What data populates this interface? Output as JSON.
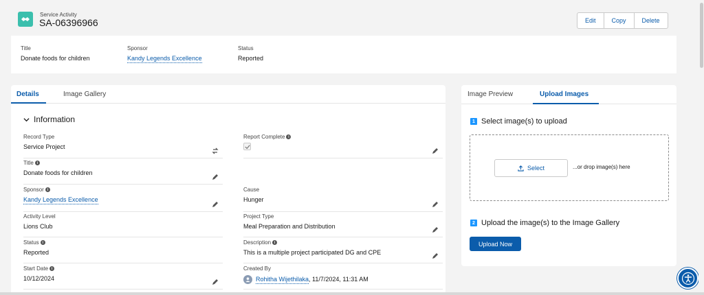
{
  "header": {
    "object_label": "Service Activity",
    "record_name": "SA-06396966",
    "icon": "handshake-icon",
    "actions": [
      "Edit",
      "Copy",
      "Delete"
    ]
  },
  "highlights": {
    "title_label": "Title",
    "title_value": "Donate foods for children",
    "sponsor_label": "Sponsor",
    "sponsor_value": "Kandy Legends Excellence",
    "status_label": "Status",
    "status_value": "Reported"
  },
  "details": {
    "tabs": [
      "Details",
      "Image Gallery"
    ],
    "section": "Information",
    "fields": {
      "record_type": {
        "label": "Record Type",
        "value": "Service Project"
      },
      "report_complete": {
        "label": "Report Complete"
      },
      "title": {
        "label": "Title",
        "value": "Donate foods for children"
      },
      "sponsor": {
        "label": "Sponsor",
        "value": "Kandy Legends Excellence"
      },
      "cause": {
        "label": "Cause",
        "value": "Hunger"
      },
      "activity_level": {
        "label": "Activity Level",
        "value": "Lions Club"
      },
      "project_type": {
        "label": "Project Type",
        "value": "Meal Preparation and Distribution"
      },
      "status": {
        "label": "Status",
        "value": "Reported"
      },
      "description": {
        "label": "Description",
        "value": "This is a multiple project participated DG and CPE"
      },
      "start_date": {
        "label": "Start Date",
        "value": "10/12/2024"
      },
      "created_by": {
        "label": "Created By",
        "user": "Rohitha Wijethilaka",
        "date": ", 11/7/2024, 11:31 AM"
      }
    }
  },
  "upload": {
    "tabs": [
      "Image Preview",
      "Upload Images"
    ],
    "step1_num": "1",
    "step1_text": "Select image(s) to upload",
    "select_label": "Select",
    "drop_text": "...or drop image(s) here",
    "step2_num": "2",
    "step2_text": "Upload the image(s) to the Image Gallery",
    "upload_button": "Upload Now"
  },
  "colors": {
    "brand": "#0b5cab",
    "icon_bg": "#3bbfad",
    "step_badge": "#1b96ff"
  }
}
